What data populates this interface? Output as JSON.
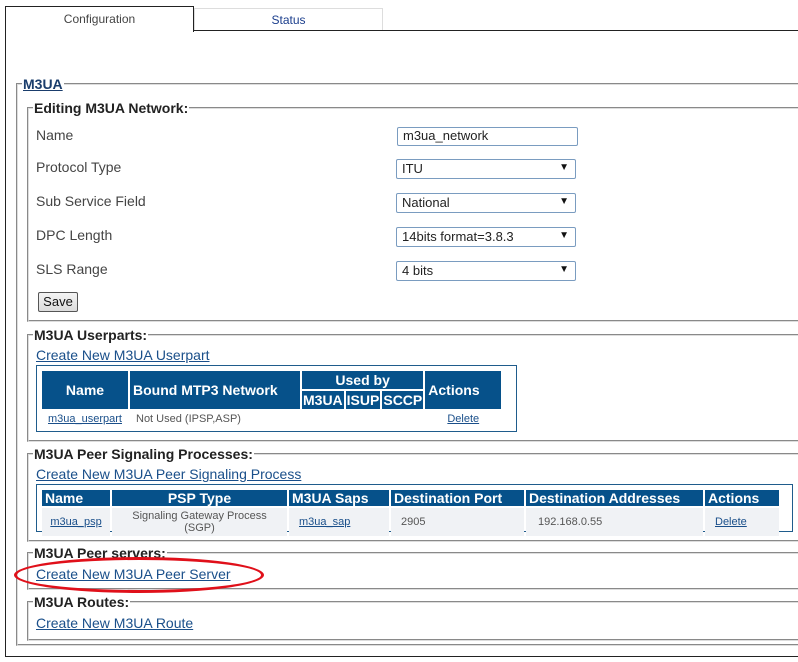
{
  "tabs": [
    {
      "label": "Configuration",
      "active": true
    },
    {
      "label": "Status",
      "active": false
    }
  ],
  "m3ua": {
    "title": "M3UA",
    "edit": {
      "legend": "Editing M3UA Network:",
      "fields": [
        {
          "label": "Name",
          "value": "m3ua_network",
          "type": "text"
        },
        {
          "label": "Protocol Type",
          "value": "ITU",
          "type": "select"
        },
        {
          "label": "Sub Service Field",
          "value": "National",
          "type": "select"
        },
        {
          "label": "DPC Length",
          "value": "14bits format=3.8.3",
          "type": "select"
        },
        {
          "label": "SLS Range",
          "value": "4 bits",
          "type": "select"
        }
      ],
      "save_label": "Save"
    },
    "userparts": {
      "legend": "M3UA Userparts:",
      "create_link": "Create New M3UA Userpart",
      "headers": {
        "name": "Name",
        "bound": "Bound MTP3 Network",
        "used_by": "Used by",
        "m3ua": "M3UA",
        "isup": "ISUP",
        "sccp": "SCCP",
        "actions": "Actions"
      },
      "rows": [
        {
          "name": "m3ua_userpart",
          "bound": "Not Used (IPSP,ASP)",
          "m3ua": "",
          "isup": "",
          "sccp": "",
          "action": "Delete"
        }
      ]
    },
    "psp": {
      "legend": "M3UA Peer Signaling Processes:",
      "create_link": "Create New M3UA Peer Signaling Process",
      "headers": [
        "Name",
        "PSP Type",
        "M3UA Saps",
        "Destination Port",
        "Destination Addresses",
        "Actions"
      ],
      "rows": [
        {
          "name": "m3ua_psp",
          "type": "Signaling Gateway Process (SGP)",
          "saps": "m3ua_sap",
          "port": "2905",
          "addresses": "192.168.0.55",
          "action": "Delete"
        }
      ]
    },
    "peer_servers": {
      "legend": "M3UA Peer servers:",
      "create_link": "Create New M3UA Peer Server",
      "highlighted": true
    },
    "routes": {
      "legend": "M3UA Routes:",
      "create_link": "Create New M3UA Route"
    }
  },
  "colors": {
    "table_header": "#06518a",
    "link": "#1a4f8a",
    "highlight": "#e0101a"
  }
}
